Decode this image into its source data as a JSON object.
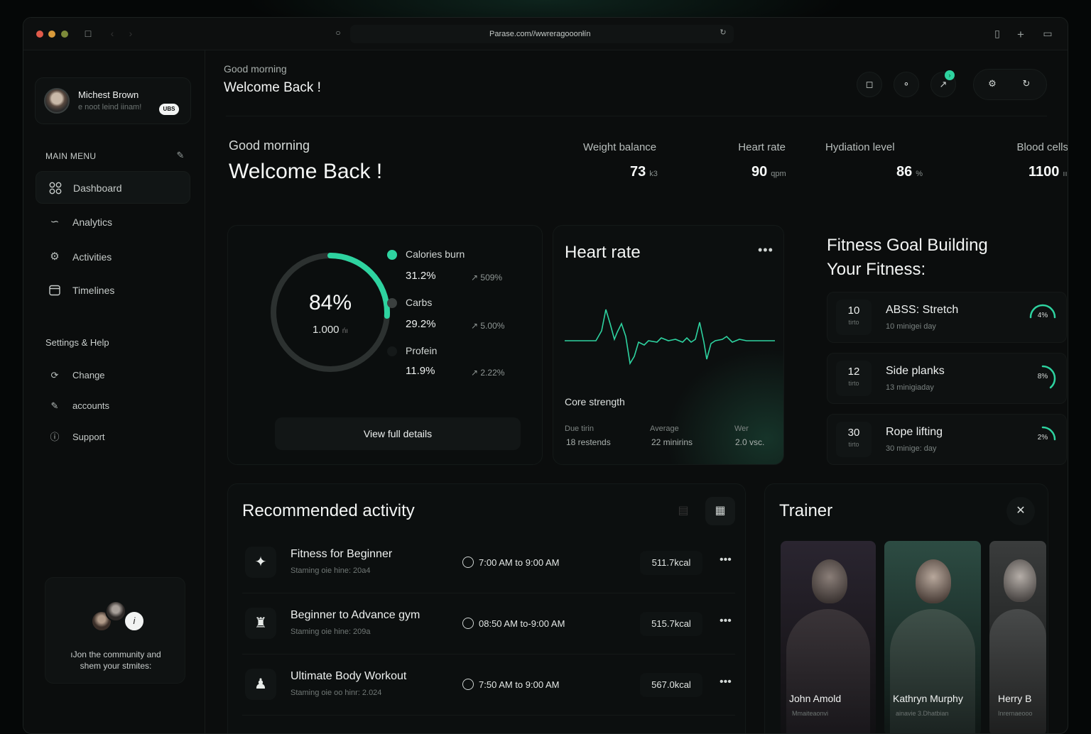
{
  "browser": {
    "url": "Parase.com//wwreragooonłín",
    "buttons": [
      "sidebar-toggle",
      "back",
      "forward",
      "reload",
      "share",
      "new-tab",
      "tabs"
    ]
  },
  "sidebar": {
    "profile": {
      "name": "Michest Brown",
      "subtitle": "е noot leind iinam!",
      "badge": "UBS"
    },
    "main_menu_label": "MAIN MENU",
    "items": [
      {
        "label": "Dashboard",
        "icon": "grid-icon",
        "active": true
      },
      {
        "label": "Analytics",
        "icon": "analytics-icon",
        "active": false
      },
      {
        "label": "Activities",
        "icon": "activities-icon",
        "active": false
      },
      {
        "label": "Timelines",
        "icon": "calendar-icon",
        "active": false
      }
    ],
    "settings_label": "Settings & Help",
    "settings_items": [
      {
        "label": "Change",
        "icon": "change-icon"
      },
      {
        "label": "accounts",
        "icon": "edit-icon"
      },
      {
        "label": "Support",
        "icon": "support-icon"
      }
    ],
    "community": {
      "text_line1": "ıJon the community and",
      "text_line2": "shem your stmites:"
    }
  },
  "header": {
    "greeting": "Good morning",
    "welcome": "Welcome Back !"
  },
  "hero": {
    "greeting": "Good morning",
    "welcome": "Welcome Back !",
    "stats": [
      {
        "label": "Weight balance",
        "value": "73",
        "unit": "k3"
      },
      {
        "label": "Heart rate",
        "value": "90",
        "unit": "qpm"
      },
      {
        "label": "Hydiation level",
        "value": "86",
        "unit": "%"
      },
      {
        "label": "Blood cells",
        "value": "1100",
        "unit": "ıı"
      }
    ]
  },
  "calories_card": {
    "progress_pct": 84,
    "progress_label": "84%",
    "sub_label": "1.000",
    "sub_unit": "ńı",
    "legend": [
      {
        "label": "Calories burn",
        "value": "31.2%",
        "change": "509%",
        "color": "#2ed3a0"
      },
      {
        "label": "Carbs",
        "value": "29.2%",
        "change": "5.00%",
        "color": "#3b403f"
      },
      {
        "label": "Profein",
        "value": "11.9%",
        "change": "2.22%",
        "color": "#151919"
      }
    ],
    "button": "View full details"
  },
  "heart_card": {
    "title": "Heart rate",
    "more": "•••",
    "section": "Core strength",
    "stats": [
      {
        "label": "Due tirin",
        "value": "18 restends"
      },
      {
        "label": "Average",
        "value": "22 minirins"
      },
      {
        "label": "Wer",
        "value": "2.0 vsc."
      }
    ]
  },
  "fitness_goal": {
    "title_line1": "Fitness Goal Building",
    "title_line2": "Your Fitness:",
    "goals": [
      {
        "num": "10",
        "unit": "tirto",
        "title": "ABSS: Stretch",
        "sub": "10 minigei day",
        "pct_label": "4%",
        "pct": 0.04
      },
      {
        "num": "12",
        "unit": "tirto",
        "title": "Side planks",
        "sub": "13 minigiaday",
        "pct_label": "8%",
        "pct": 0.08
      },
      {
        "num": "30",
        "unit": "tirto",
        "title": "Rope lifting",
        "sub": "30 minige: day",
        "pct_label": "2%",
        "pct": 0.02
      }
    ]
  },
  "recommended": {
    "title": "Recommended activity",
    "rows": [
      {
        "name": "Fitness for Beginner",
        "sub": "Staming oie hine: 20а4",
        "time": "7:00 AM to 9:00 AM",
        "kcal": "511.7kcal",
        "icon": "runner-icon"
      },
      {
        "name": "Beginner to Advance gym",
        "sub": "Staming oie hine: 209а",
        "time": "08:50 AM to-9:00 AM",
        "kcal": "515.7kcal",
        "icon": "gym-icon"
      },
      {
        "name": "Ultimate Body Workout",
        "sub": "Staming oie oo hinr: 2.024",
        "time": "7:50 AM to 9:00 AM",
        "kcal": "567.0kcal",
        "icon": "workout-icon"
      }
    ]
  },
  "trainer": {
    "title": "Trainer",
    "cards": [
      {
        "name": "John Amold",
        "role": "Mmaiteaonvi"
      },
      {
        "name": "Kathryn Murphy",
        "role": "ainavie 3.Dhatbian"
      },
      {
        "name": "Herry B",
        "role": "Inrernaeooo"
      }
    ]
  },
  "colors": {
    "accent": "#2ed3a0",
    "background": "#0b0d0d",
    "card": "#0c0f0f"
  }
}
